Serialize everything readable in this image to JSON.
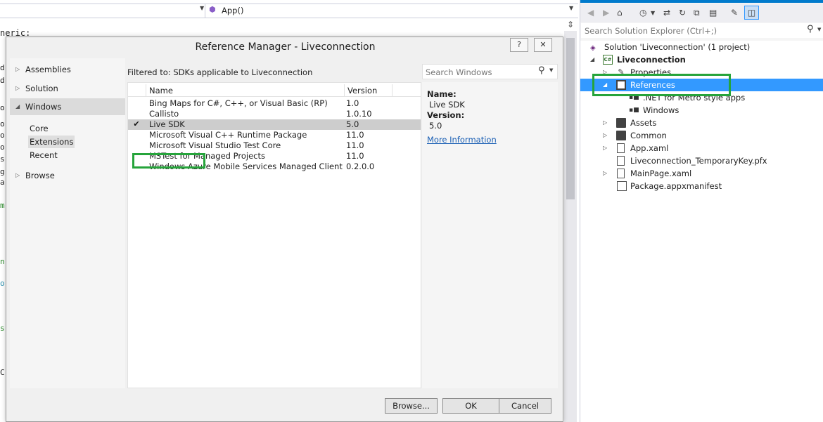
{
  "editor": {
    "nav_right_label": "App()",
    "code_line": "neric:",
    "fragments": [
      "d",
      "d",
      "o",
      "o",
      "o",
      "o",
      "s",
      "g",
      "a",
      "m",
      "n",
      "o",
      "s",
      "C"
    ]
  },
  "dialog": {
    "title": "Reference Manager - Liveconnection",
    "help_label": "?",
    "close_label": "✕",
    "categories": [
      {
        "label": "Assemblies"
      },
      {
        "label": "Solution"
      },
      {
        "label": "Windows"
      },
      {
        "label": "Browse"
      }
    ],
    "subcategories": [
      {
        "label": "Core"
      },
      {
        "label": "Extensions"
      },
      {
        "label": "Recent"
      }
    ],
    "filter_text": "Filtered to: SDKs applicable to Liveconnection",
    "search_placeholder": "Search Windows",
    "columns": {
      "name": "Name",
      "version": "Version"
    },
    "rows": [
      {
        "name": "Bing Maps for C#, C++, or Visual Basic (RP)",
        "version": "1.0"
      },
      {
        "name": "Callisto",
        "version": "1.0.10"
      },
      {
        "name": "Live SDK",
        "version": "5.0",
        "check": "✔"
      },
      {
        "name": "Microsoft Visual C++ Runtime Package",
        "version": "11.0"
      },
      {
        "name": "Microsoft Visual Studio Test Core",
        "version": "11.0"
      },
      {
        "name": "MSTest for Managed Projects",
        "version": "11.0"
      },
      {
        "name": "Windows Azure Mobile Services Managed Client",
        "version": "0.2.0.0"
      }
    ],
    "details": {
      "name_label": "Name:",
      "name_value": "Live SDK",
      "version_label": "Version:",
      "version_value": "5.0",
      "more_info": "More Information"
    },
    "buttons": {
      "browse": "Browse...",
      "ok": "OK",
      "cancel": "Cancel"
    }
  },
  "solution_explorer": {
    "search_placeholder": "Search Solution Explorer (Ctrl+;)",
    "tree": [
      {
        "label": "Solution 'Liveconnection' (1 project)"
      },
      {
        "label": "Liveconnection"
      },
      {
        "label": "Properties"
      },
      {
        "label": "References"
      },
      {
        "label": ".NET for Metro style apps"
      },
      {
        "label": "Windows"
      },
      {
        "label": "Assets"
      },
      {
        "label": "Common"
      },
      {
        "label": "App.xaml"
      },
      {
        "label": "Liveconnection_TemporaryKey.pfx"
      },
      {
        "label": "MainPage.xaml"
      },
      {
        "label": "Package.appxmanifest"
      }
    ]
  },
  "colors": {
    "accent": "#007acc",
    "selection": "#3399ff",
    "highlight_box": "#26a43b",
    "link": "#1a5fb4"
  }
}
